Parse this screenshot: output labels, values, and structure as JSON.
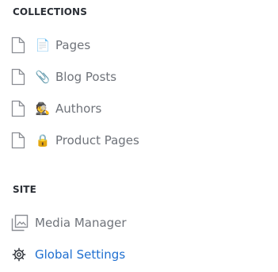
{
  "sections": {
    "collections": {
      "title": "COLLECTIONS",
      "items": [
        {
          "label": "Pages",
          "emoji": "📄"
        },
        {
          "label": "Blog Posts",
          "emoji": "📎"
        },
        {
          "label": "Authors",
          "emoji": "🕵️"
        },
        {
          "label": "Product Pages",
          "emoji": "🔒"
        }
      ]
    },
    "site": {
      "title": "SITE",
      "items": [
        {
          "label": "Media Manager",
          "icon": "image-gallery-icon"
        },
        {
          "label": "Global Settings",
          "icon": "gear-icon",
          "active": true
        }
      ]
    }
  },
  "colors": {
    "text_muted": "#6f737a",
    "section_title": "#2b2f36",
    "active_link": "#1f6fd0"
  }
}
